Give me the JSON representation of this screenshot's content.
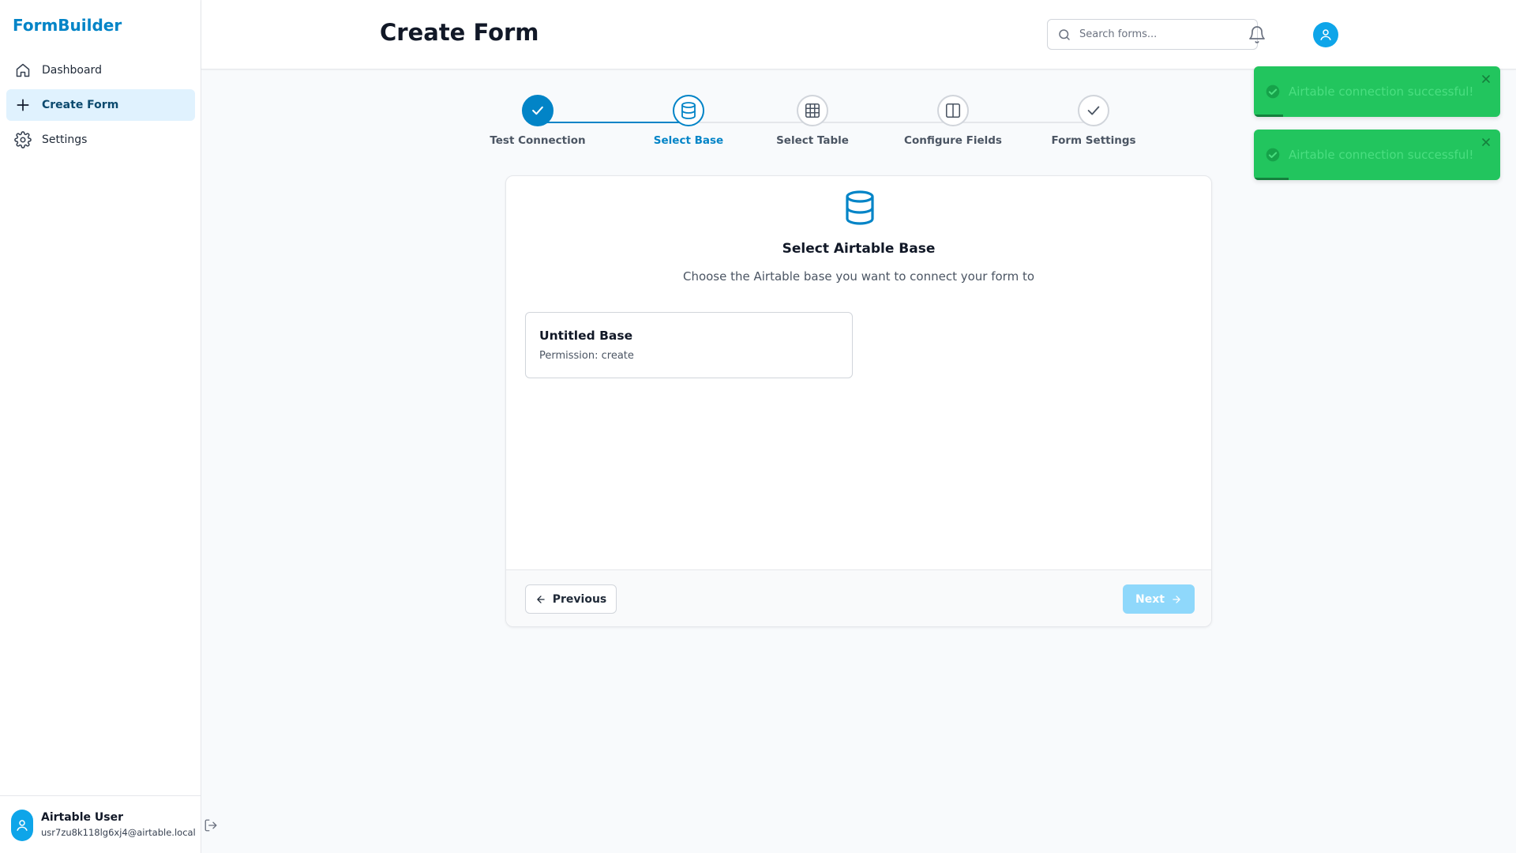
{
  "app": {
    "brand": "FormBuilder"
  },
  "sidebar": {
    "items": [
      {
        "label": "Dashboard",
        "icon": "home-icon",
        "active": false
      },
      {
        "label": "Create Form",
        "icon": "plus-icon",
        "active": true
      },
      {
        "label": "Settings",
        "icon": "gear-icon",
        "active": false
      }
    ],
    "user": {
      "name": "Airtable User",
      "email": "usr7zu8k118lg6xj4@airtable.local"
    }
  },
  "header": {
    "title": "Create Form",
    "search_placeholder": "Search forms..."
  },
  "stepper": {
    "steps": [
      {
        "label": "Test Connection",
        "status": "done",
        "icon": "check-icon"
      },
      {
        "label": "Select Base",
        "status": "current",
        "icon": "database-icon"
      },
      {
        "label": "Select Table",
        "status": "pending",
        "icon": "table-icon"
      },
      {
        "label": "Configure Fields",
        "status": "pending",
        "icon": "columns-icon"
      },
      {
        "label": "Form Settings",
        "status": "pending",
        "icon": "check-icon"
      }
    ]
  },
  "card": {
    "title": "Select Airtable Base",
    "subtitle": "Choose the Airtable base you want to connect your form to",
    "bases": [
      {
        "name": "Untitled Base",
        "permission": "Permission: create"
      }
    ],
    "prev_label": "Previous",
    "next_label": "Next"
  },
  "toasts": [
    {
      "message": "Airtable connection successful!",
      "progress": 0.12
    },
    {
      "message": "Airtable connection successful!",
      "progress": 0.14
    }
  ],
  "colors": {
    "accent": "#0284c7",
    "accent_light": "#e0f2fe",
    "toast_bg": "#22c55e",
    "next_disabled": "#7dd3fc"
  }
}
